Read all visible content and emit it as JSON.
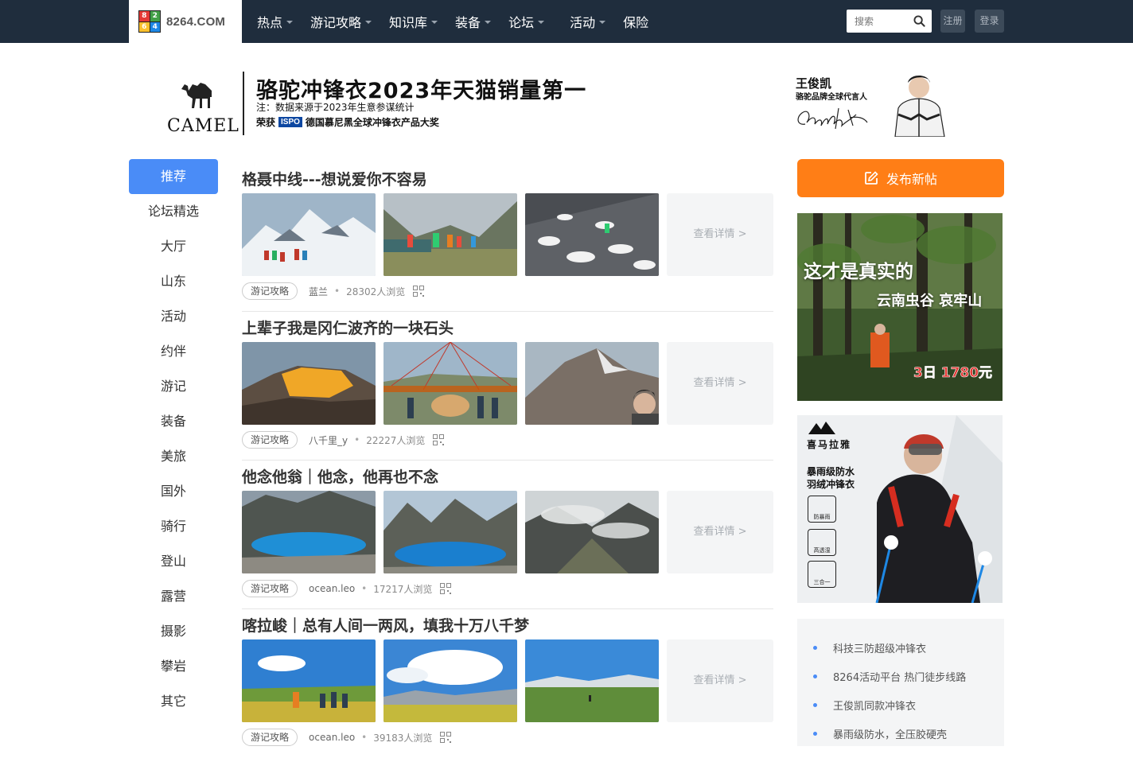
{
  "header": {
    "logo_text": "8264.COM",
    "logo_cells": [
      "8",
      "2",
      "6",
      "4"
    ],
    "nav": [
      {
        "label": "热点",
        "caret": true
      },
      {
        "label": "游记攻略",
        "caret": true
      },
      {
        "label": "知识库",
        "caret": true
      },
      {
        "label": "装备",
        "caret": true
      },
      {
        "label": "论坛",
        "caret": true
      },
      {
        "label": "活动",
        "caret": true
      },
      {
        "label": "保险",
        "caret": false
      }
    ],
    "search_placeholder": "搜索",
    "register": "注册",
    "login": "登录"
  },
  "banner": {
    "brand": "CAMEL",
    "title": "骆驼冲锋衣2023年天猫销量第一",
    "note": "注：数据来源于2023年生意参谋统计",
    "award_prefix": "荣获",
    "award_logo": "ISPO",
    "award_text": "德国慕尼黑全球冲锋衣产品大奖",
    "spokesman_name": "王俊凯",
    "spokesman_title": "骆驼品牌全球代言人"
  },
  "sidebar": {
    "items": [
      "推荐",
      "论坛精选",
      "大厅",
      "山东",
      "活动",
      "约伴",
      "游记",
      "装备",
      "美旅",
      "国外",
      "骑行",
      "登山",
      "露营",
      "摄影",
      "攀岩",
      "其它"
    ],
    "active_index": 0
  },
  "posts": [
    {
      "title": "格聂中线---想说爱你不容易",
      "tag": "游记攻略",
      "author": "蓝兰",
      "views": "28302人浏览",
      "detail": "查看详情 >"
    },
    {
      "title": "上辈子我是冈仁波齐的一块石头",
      "tag": "游记攻略",
      "author": "八千里_y",
      "views": "22227人浏览",
      "detail": "查看详情 >"
    },
    {
      "title": "他念他翁｜他念，他再也不念",
      "tag": "游记攻略",
      "author": "ocean.leo",
      "views": "17217人浏览",
      "detail": "查看详情 >"
    },
    {
      "title": "喀拉峻｜总有人间一两风，填我十万八千梦",
      "tag": "游记攻略",
      "author": "ocean.leo",
      "views": "39183人浏览",
      "detail": "查看详情 >"
    }
  ],
  "right": {
    "post_button": "发布新帖",
    "ad1": {
      "title": "这才是真实的",
      "subtitle": "云南虫谷 哀牢山",
      "price": "3日 1780元"
    },
    "ad2": {
      "brand": "喜马拉雅",
      "line1": "暴雨级防水",
      "line2": "羽绒冲锋衣",
      "features": [
        "防暴雨",
        "高透湿",
        "三合一"
      ]
    },
    "links": [
      "科技三防超级冲锋衣",
      "8264活动平台 热门徒步线路",
      "王俊凯同款冲锋衣",
      "暴雨级防水，全压胶硬壳"
    ]
  },
  "colors": {
    "nav_bg": "#1f2d3d",
    "accent_blue": "#4a8cf7",
    "post_orange": "#ff7e16"
  }
}
